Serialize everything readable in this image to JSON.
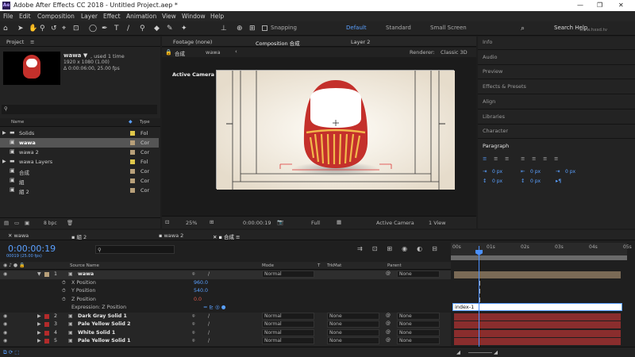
{
  "window": {
    "title": "Adobe After Effects CC 2018 - Untitled Project.aep *",
    "logo": "Ae",
    "controls": [
      "—",
      "❐",
      "✕"
    ]
  },
  "menu": [
    "File",
    "Edit",
    "Composition",
    "Layer",
    "Effect",
    "Animation",
    "View",
    "Window",
    "Help"
  ],
  "toolbar": {
    "snapping": "Snapping",
    "workspaces": [
      "Default",
      "Standard",
      "Small Screen"
    ],
    "search": "Search Help",
    "watermark": "www.hxsd.tv"
  },
  "project": {
    "tab": "Project",
    "thumb_name": "wawa ▼",
    "thumb_used": ", used 1 time",
    "thumb_res": "1920 x 1080 (1.00)",
    "thumb_dur": "Δ 0:00:06:00, 25.00 fps",
    "col_name": "Name",
    "col_type": "Type",
    "items": [
      {
        "name": "Solids",
        "type": "Fol",
        "color": "#e0c84a",
        "kind": "folder"
      },
      {
        "name": "wawa",
        "type": "Cor",
        "color": "#b8a07a",
        "kind": "comp",
        "selected": true
      },
      {
        "name": "wawa 2",
        "type": "Cor",
        "color": "#b8a07a",
        "kind": "comp"
      },
      {
        "name": "wawa Layers",
        "type": "Fol",
        "color": "#e0c84a",
        "kind": "folder"
      },
      {
        "name": "合成",
        "type": "Cor",
        "color": "#b8a07a",
        "kind": "comp"
      },
      {
        "name": "組",
        "type": "Cor",
        "color": "#b8a07a",
        "kind": "comp"
      },
      {
        "name": "組 2",
        "type": "Cor",
        "color": "#b8a07a",
        "kind": "comp"
      }
    ],
    "bpc": "8 bpc"
  },
  "viewer": {
    "tabs": [
      "Footage (none)",
      "Composition 合成",
      "Layer 2"
    ],
    "crumbs": [
      "合成",
      "wawa"
    ],
    "renderer_label": "Renderer:",
    "renderer": "Classic 3D",
    "camera_label": "Active Camera",
    "zoom": "25%",
    "time": "0:00:00:19",
    "quality": "Full",
    "view": "Active Camera",
    "views": "1 View",
    "nav_left": "‹",
    "nav_right": "›"
  },
  "right_panels": [
    "Info",
    "Audio",
    "Preview",
    "Effects & Presets",
    "Align",
    "Libraries",
    "Character",
    "Paragraph"
  ],
  "paragraph": {
    "v1": "0 px",
    "v2": "0 px",
    "v3": "0 px",
    "v4": "0 px",
    "v5": "0 px"
  },
  "timeline": {
    "tabs": [
      "wawa",
      "組 2",
      "wawa 2",
      "合成"
    ],
    "timecode": "0:00:00:19",
    "frame": "00019 (25.00 fps)",
    "col_source": "Source Name",
    "col_mode": "Mode",
    "col_trk": "TrkMat",
    "col_parent": "Parent",
    "ruler": [
      "00s",
      "01s",
      "02s",
      "03s",
      "04s",
      "05s"
    ],
    "layers": [
      {
        "num": "1",
        "name": "wawa",
        "color": "#b8a07a",
        "mode": "Normal",
        "trk": "",
        "parent": "None",
        "expanded": true
      },
      {
        "num": "2",
        "name": "Dark Gray Solid 1",
        "color": "#b32b2b",
        "mode": "Normal",
        "trk": "None",
        "parent": "None"
      },
      {
        "num": "3",
        "name": "Pale Yellow Solid 2",
        "color": "#b32b2b",
        "mode": "Normal",
        "trk": "None",
        "parent": "None"
      },
      {
        "num": "4",
        "name": "White Solid 1",
        "color": "#b32b2b",
        "mode": "Normal",
        "trk": "None",
        "parent": "None"
      },
      {
        "num": "5",
        "name": "Pale Yellow Solid 1",
        "color": "#b32b2b",
        "mode": "Normal",
        "trk": "None",
        "parent": "None"
      }
    ],
    "props": [
      {
        "name": "X Position",
        "value": "960.0"
      },
      {
        "name": "Y Position",
        "value": "540.0"
      },
      {
        "name": "Z Position",
        "value": "0.0"
      }
    ],
    "expr_label": "Expression: Z Position",
    "expr_text": "index-1"
  }
}
